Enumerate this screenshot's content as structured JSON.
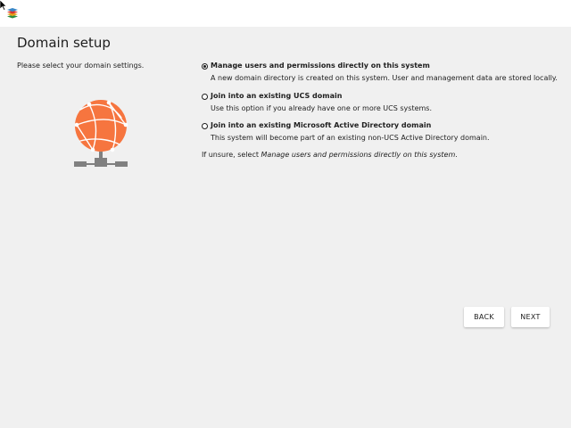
{
  "header": {
    "logo_icon": "ucs-layers-icon"
  },
  "page": {
    "title": "Domain setup",
    "intro": "Please select your domain settings."
  },
  "graphic": {
    "icon": "network-globe-icon",
    "accent_color": "#f6753f",
    "base_color": "#808080"
  },
  "options": [
    {
      "label": "Manage users and permissions directly on this system",
      "description": "A new domain directory is created on this system. User and management data are stored locally.",
      "selected": true
    },
    {
      "label": "Join into an existing UCS domain",
      "description": "Use this option if you already have one or more UCS systems.",
      "selected": false
    },
    {
      "label": "Join into an existing Microsoft Active Directory domain",
      "description": "This system will become part of an existing non-UCS Active Directory domain.",
      "selected": false
    }
  ],
  "hint": {
    "prefix": "If unsure, select ",
    "emphasis": "Manage users and permissions directly on this system",
    "suffix": "."
  },
  "buttons": {
    "back": "BACK",
    "next": "NEXT"
  }
}
